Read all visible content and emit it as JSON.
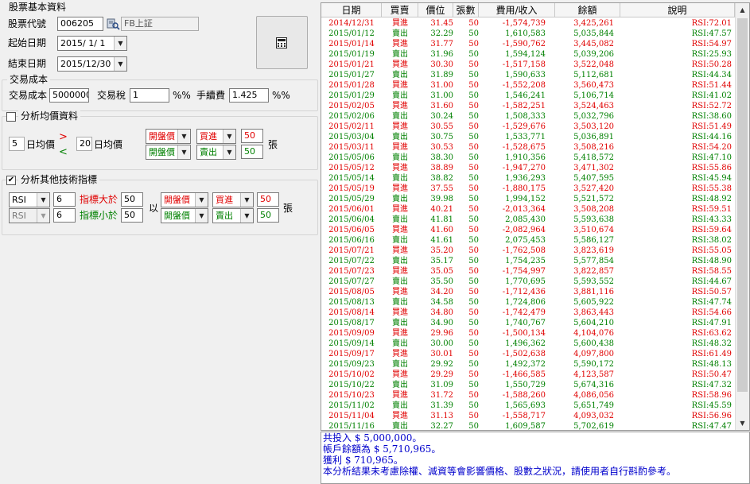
{
  "left": {
    "stock_group": {
      "title": "股票基本資料",
      "code_label": "股票代號",
      "code_value": "006205",
      "name_value": "FB上証",
      "start_label": "起始日期",
      "start_value": "2015/ 1/ 1",
      "end_label": "結束日期",
      "end_value": "2015/12/30",
      "calc_icon": "calculator-icon",
      "search_icon": "search-icon"
    },
    "cost_group": {
      "title": "交易成本",
      "cost_label": "交易成本",
      "cost_value": "5000000",
      "tax_label": "交易稅",
      "tax_value": "1",
      "tax_unit": "%%",
      "fee_label": "手續費",
      "fee_value": "1.425",
      "fee_unit": "%%"
    },
    "ma_group": {
      "title": "分析均價資料",
      "checked": false,
      "ma1_value": "5",
      "ma1_label": "日均價",
      "ma2_value": "20",
      "ma2_label": "日均價",
      "gt_symbol": ">",
      "lt_symbol": "<",
      "row1_price": "開盤價",
      "row1_action": "買進",
      "row1_qty": "50",
      "row2_price": "開盤價",
      "row2_action": "賣出",
      "row2_qty": "50",
      "unit": "張"
    },
    "tech_group": {
      "title": "分析其他技術指標",
      "checked": true,
      "row1_indicator": "RSI",
      "row1_period": "6",
      "row1_label": "指標大於",
      "row1_value": "50",
      "row2_indicator": "RSI",
      "row2_period": "6",
      "row2_label": "指標小於",
      "row2_value": "50",
      "by_label": "以",
      "row1_price": "開盤價",
      "row1_action": "買進",
      "row1_qty": "50",
      "row2_price": "開盤價",
      "row2_action": "賣出",
      "row2_qty": "50",
      "unit": "張"
    }
  },
  "table": {
    "headers": [
      "日期",
      "買賣",
      "價位",
      "張數",
      "費用/收入",
      "餘額",
      "說明"
    ],
    "buy_color": "#e00000",
    "sell_color": "#008000",
    "rows": [
      [
        "2014/12/31",
        "買進",
        "31.45",
        "50",
        "-1,574,739",
        "3,425,261",
        "RSI:72.01"
      ],
      [
        "2015/01/12",
        "賣出",
        "32.29",
        "50",
        "1,610,583",
        "5,035,844",
        "RSI:47.57"
      ],
      [
        "2015/01/14",
        "買進",
        "31.77",
        "50",
        "-1,590,762",
        "3,445,082",
        "RSI:54.97"
      ],
      [
        "2015/01/19",
        "賣出",
        "31.96",
        "50",
        "1,594,124",
        "5,039,206",
        "RSI:25.93"
      ],
      [
        "2015/01/21",
        "買進",
        "30.30",
        "50",
        "-1,517,158",
        "3,522,048",
        "RSI:50.28"
      ],
      [
        "2015/01/27",
        "賣出",
        "31.89",
        "50",
        "1,590,633",
        "5,112,681",
        "RSI:44.34"
      ],
      [
        "2015/01/28",
        "買進",
        "31.00",
        "50",
        "-1,552,208",
        "3,560,473",
        "RSI:51.44"
      ],
      [
        "2015/01/29",
        "賣出",
        "31.00",
        "50",
        "1,546,241",
        "5,106,714",
        "RSI:41.02"
      ],
      [
        "2015/02/05",
        "買進",
        "31.60",
        "50",
        "-1,582,251",
        "3,524,463",
        "RSI:52.72"
      ],
      [
        "2015/02/06",
        "賣出",
        "30.24",
        "50",
        "1,508,333",
        "5,032,796",
        "RSI:38.60"
      ],
      [
        "2015/02/11",
        "買進",
        "30.55",
        "50",
        "-1,529,676",
        "3,503,120",
        "RSI:51.49"
      ],
      [
        "2015/03/04",
        "賣出",
        "30.75",
        "50",
        "1,533,771",
        "5,036,891",
        "RSI:44.16"
      ],
      [
        "2015/03/11",
        "買進",
        "30.53",
        "50",
        "-1,528,675",
        "3,508,216",
        "RSI:54.20"
      ],
      [
        "2015/05/06",
        "賣出",
        "38.30",
        "50",
        "1,910,356",
        "5,418,572",
        "RSI:47.10"
      ],
      [
        "2015/05/12",
        "買進",
        "38.89",
        "50",
        "-1,947,270",
        "3,471,302",
        "RSI:55.86"
      ],
      [
        "2015/05/14",
        "賣出",
        "38.82",
        "50",
        "1,936,293",
        "5,407,595",
        "RSI:45.94"
      ],
      [
        "2015/05/19",
        "買進",
        "37.55",
        "50",
        "-1,880,175",
        "3,527,420",
        "RSI:55.38"
      ],
      [
        "2015/05/29",
        "賣出",
        "39.98",
        "50",
        "1,994,152",
        "5,521,572",
        "RSI:48.92"
      ],
      [
        "2015/06/01",
        "買進",
        "40.21",
        "50",
        "-2,013,364",
        "3,508,208",
        "RSI:59.51"
      ],
      [
        "2015/06/04",
        "賣出",
        "41.81",
        "50",
        "2,085,430",
        "5,593,638",
        "RSI:43.33"
      ],
      [
        "2015/06/05",
        "買進",
        "41.60",
        "50",
        "-2,082,964",
        "3,510,674",
        "RSI:59.64"
      ],
      [
        "2015/06/16",
        "賣出",
        "41.61",
        "50",
        "2,075,453",
        "5,586,127",
        "RSI:38.02"
      ],
      [
        "2015/07/21",
        "買進",
        "35.20",
        "50",
        "-1,762,508",
        "3,823,619",
        "RSI:55.05"
      ],
      [
        "2015/07/22",
        "賣出",
        "35.17",
        "50",
        "1,754,235",
        "5,577,854",
        "RSI:48.90"
      ],
      [
        "2015/07/23",
        "買進",
        "35.05",
        "50",
        "-1,754,997",
        "3,822,857",
        "RSI:58.55"
      ],
      [
        "2015/07/27",
        "賣出",
        "35.50",
        "50",
        "1,770,695",
        "5,593,552",
        "RSI:44.67"
      ],
      [
        "2015/08/05",
        "買進",
        "34.20",
        "50",
        "-1,712,436",
        "3,881,116",
        "RSI:50.57"
      ],
      [
        "2015/08/13",
        "賣出",
        "34.58",
        "50",
        "1,724,806",
        "5,605,922",
        "RSI:47.74"
      ],
      [
        "2015/08/14",
        "買進",
        "34.80",
        "50",
        "-1,742,479",
        "3,863,443",
        "RSI:54.66"
      ],
      [
        "2015/08/17",
        "賣出",
        "34.90",
        "50",
        "1,740,767",
        "5,604,210",
        "RSI:47.91"
      ],
      [
        "2015/09/09",
        "買進",
        "29.96",
        "50",
        "-1,500,134",
        "4,104,076",
        "RSI:63.62"
      ],
      [
        "2015/09/14",
        "賣出",
        "30.00",
        "50",
        "1,496,362",
        "5,600,438",
        "RSI:48.32"
      ],
      [
        "2015/09/17",
        "買進",
        "30.01",
        "50",
        "-1,502,638",
        "4,097,800",
        "RSI:61.49"
      ],
      [
        "2015/09/23",
        "賣出",
        "29.92",
        "50",
        "1,492,372",
        "5,590,172",
        "RSI:48.13"
      ],
      [
        "2015/10/02",
        "買進",
        "29.29",
        "50",
        "-1,466,585",
        "4,123,587",
        "RSI:50.47"
      ],
      [
        "2015/10/22",
        "賣出",
        "31.09",
        "50",
        "1,550,729",
        "5,674,316",
        "RSI:47.32"
      ],
      [
        "2015/10/23",
        "買進",
        "31.72",
        "50",
        "-1,588,260",
        "4,086,056",
        "RSI:58.96"
      ],
      [
        "2015/11/02",
        "賣出",
        "31.39",
        "50",
        "1,565,693",
        "5,651,749",
        "RSI:45.59"
      ],
      [
        "2015/11/04",
        "買進",
        "31.13",
        "50",
        "-1,558,717",
        "4,093,032",
        "RSI:56.96"
      ],
      [
        "2015/11/16",
        "賣出",
        "32.27",
        "50",
        "1,609,587",
        "5,702,619",
        "RSI:47.47"
      ]
    ]
  },
  "summary": {
    "line1": "共投入 $ 5,000,000。",
    "line2": "帳戶餘額為 $ 5,710,965。",
    "line3": "獲利 $ 710,965。",
    "line4": "本分析結果未考慮除權、減資等會影響價格、股數之狀況，請使用者自行斟酌參考。"
  }
}
